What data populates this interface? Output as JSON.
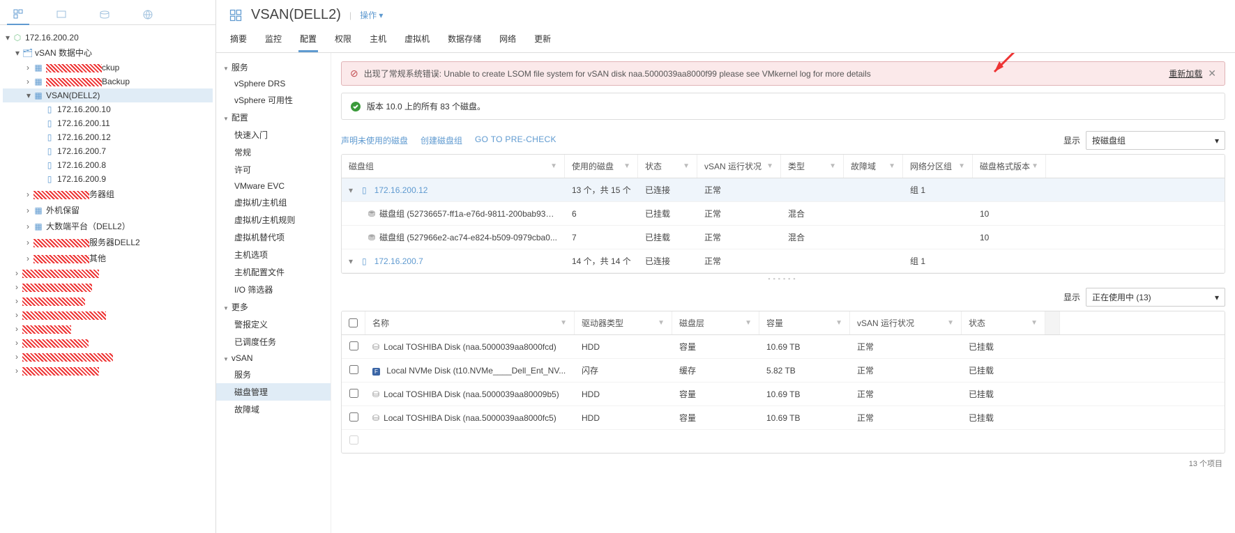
{
  "left_tabs_active": 0,
  "tree": {
    "vc": "172.16.200.20",
    "dc": "vSAN 数据中心",
    "clusters_obscured": [
      "ckup",
      "Backup"
    ],
    "selected_cluster": "VSAN(DELL2)",
    "hosts": [
      "172.16.200.10",
      "172.16.200.11",
      "172.16.200.12",
      "172.16.200.7",
      "172.16.200.8",
      "172.16.200.9"
    ],
    "obscured_siblings": [
      "务器组",
      "外机保留",
      "大数端平台（DELL2）",
      "服务器DELL2",
      "其他",
      "",
      "",
      "",
      "",
      "",
      "",
      "",
      ""
    ]
  },
  "header": {
    "title": "VSAN(DELL2)",
    "actions_label": "操作"
  },
  "tabs": [
    "摘要",
    "监控",
    "配置",
    "权限",
    "主机",
    "虚拟机",
    "数据存储",
    "网络",
    "更新"
  ],
  "active_tab": 2,
  "config_nav": {
    "groups": [
      {
        "label": "服务",
        "items": [
          "vSphere DRS",
          "vSphere 可用性"
        ]
      },
      {
        "label": "配置",
        "items": [
          "快速入门",
          "常规",
          "许可",
          "VMware EVC",
          "虚拟机/主机组",
          "虚拟机/主机规则",
          "虚拟机替代项",
          "主机选项",
          "主机配置文件",
          "I/O 筛选器"
        ]
      },
      {
        "label": "更多",
        "items": [
          "警报定义",
          "已调度任务"
        ]
      },
      {
        "label": "vSAN",
        "items": [
          "服务",
          "磁盘管理",
          "故障域"
        ]
      }
    ],
    "active": "磁盘管理"
  },
  "alert": {
    "prefix": "出现了常规系统错误:",
    "message": "Unable to create LSOM file system for vSAN disk naa.5000039aa8000f99 please see VMkernel log for more details",
    "reload": "重新加载"
  },
  "ok_bar": "版本 10.0 上的所有 83 个磁盘。",
  "dg_toolbar": {
    "claim": "声明未使用的磁盘",
    "create": "创建磁盘组",
    "precheck": "GO TO PRE-CHECK",
    "show_label": "显示",
    "show_value": "按磁盘组"
  },
  "dg_cols": [
    "磁盘组",
    "使用的磁盘",
    "状态",
    "vSAN 运行状况",
    "类型",
    "故障域",
    "网络分区组",
    "磁盘格式版本"
  ],
  "dg_rows": [
    {
      "kind": "host",
      "name": "172.16.200.12",
      "used": "13 个，共 15 个",
      "state": "已连接",
      "vsan": "正常",
      "type": "",
      "fault": "",
      "net": "组 1",
      "fmt": "",
      "sel": true
    },
    {
      "kind": "dg",
      "name": "磁盘组 (52736657-ff1a-e76d-9811-200bab933f...",
      "used": "6",
      "state": "已挂载",
      "vsan": "正常",
      "type": "混合",
      "fault": "",
      "net": "",
      "fmt": "10"
    },
    {
      "kind": "dg",
      "name": "磁盘组 (527966e2-ac74-e824-b509-0979cba0...",
      "used": "7",
      "state": "已挂载",
      "vsan": "正常",
      "type": "混合",
      "fault": "",
      "net": "",
      "fmt": "10"
    },
    {
      "kind": "host",
      "name": "172.16.200.7",
      "used": "14 个，共 14 个",
      "state": "已连接",
      "vsan": "正常",
      "type": "",
      "fault": "",
      "net": "组 1",
      "fmt": ""
    }
  ],
  "disk_toolbar": {
    "show_label": "显示",
    "show_value": "正在使用中 (13)"
  },
  "disk_cols": [
    "",
    "名称",
    "驱动器类型",
    "磁盘层",
    "容量",
    "vSAN 运行状况",
    "状态"
  ],
  "disk_rows": [
    {
      "name": "Local TOSHIBA Disk (naa.5000039aa8000fcd)",
      "icon": "hdd",
      "drv": "HDD",
      "tier": "容量",
      "cap": "10.69 TB",
      "vsan": "正常",
      "state": "已挂载"
    },
    {
      "name": "Local NVMe Disk (t10.NVMe____Dell_Ent_NV...",
      "icon": "nvme",
      "drv": "闪存",
      "tier": "缓存",
      "cap": "5.82 TB",
      "vsan": "正常",
      "state": "已挂载"
    },
    {
      "name": "Local TOSHIBA Disk (naa.5000039aa80009b5)",
      "icon": "hdd",
      "drv": "HDD",
      "tier": "容量",
      "cap": "10.69 TB",
      "vsan": "正常",
      "state": "已挂载"
    },
    {
      "name": "Local TOSHIBA Disk (naa.5000039aa8000fc5)",
      "icon": "hdd",
      "drv": "HDD",
      "tier": "容量",
      "cap": "10.69 TB",
      "vsan": "正常",
      "state": "已挂载"
    }
  ],
  "disk_footer": "13 个项目"
}
